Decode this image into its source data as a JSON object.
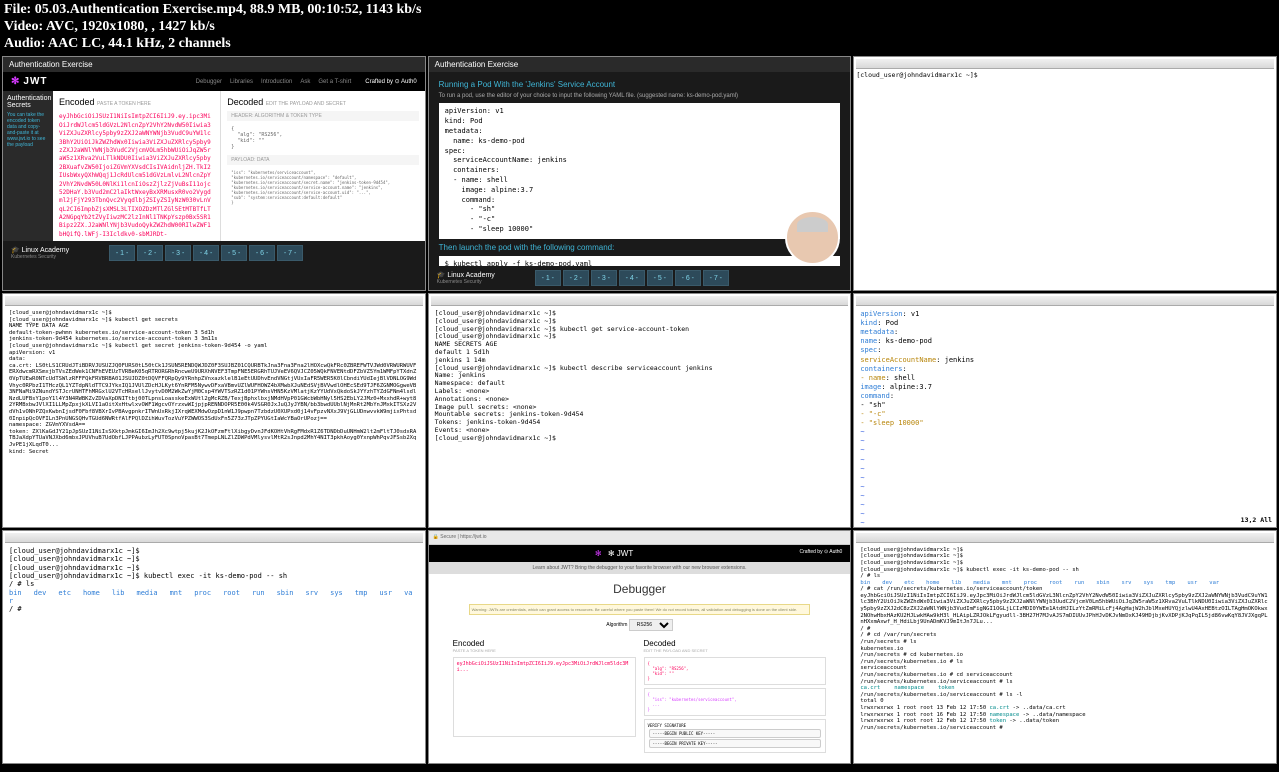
{
  "file_info": {
    "line1": "File: 05.03.Authentication Exercise.mp4, 88.9 MB, 00:10:52, 1143 kb/s",
    "line2": "Video: AVC, 1920x1080, , 1427 kb/s",
    "line3": "Audio: AAC LC, 44.1 kHz, 2 channels"
  },
  "cell1": {
    "top_title": "Authentication Exercise",
    "logo": "JWT",
    "nav": [
      "Debugger",
      "Libraries",
      "Introduction",
      "Ask",
      "Get a T-shirt"
    ],
    "crafted": "Crafted by ⊙ Auth0",
    "sidebar_title": "Authentication Secrets",
    "sidebar_text": "You can take the encoded token data and copy-and-paste it at www.jwt.io to see the payload",
    "encoded_title": "Encoded",
    "encoded_sub": "PASTE A TOKEN HERE",
    "decoded_title": "Decoded",
    "decoded_sub": "EDIT THE PAYLOAD AND SECRET",
    "section_header": "HEADER: ALGORITHM & TOKEN TYPE",
    "section_payload": "PAYLOAD: DATA",
    "json_header": "{\n  \"alg\": \"RS256\",\n  \"kid\": \"\"\n}",
    "json_payload": "\"iss\": \"kubernetes/serviceaccount\",\n\"kubernetes.io/serviceaccount/namespace\": \"default\",\n\"kubernetes.io/serviceaccount/secret.name\": \"jenkins-token-9d454\",\n\"kubernetes.io/serviceaccount/service-account.name\": \"jenkins\",\n\"kubernetes.io/serviceaccount/service-account.uid\": \"...\",\n\"sub\": \"system:serviceaccount:default:default\"\n}",
    "token": {
      "p1": "eyJhbGciOiJSUzI1NiIsImtpZCI6IiJ9.ey.ipc3MiOiJrdWJlcm5ldGVzL2NlcnZpY2VhY2NvdW50Iiwia3ViZXJuZXRlcy5pby9zZXJ2aWNYWNjb3VudC9uYW1lc3BhY2UiOiJkZWZhdWx0Iiwia3ViZXJuZXRlcy5pby9zZXJ2aWNlYWNjb3VudC2VjcmVOLm5hbWUiOiJqZW5raW5z1XRva2VuLTlkNDU0Iiwia3ViZXJuZXRlcy5pby2BXuafvZW50IjoiZGVmYXVsdCIsIVAidnljZH.TkI2IUsbWxyQXhWQqj1JcRdUlcm51dGVzLmlvL2NlcnZpY2VhY2NvdW50L0NlKi1lcnIiOszZjlzZjVuBsI11ojc52DHaY.b3Vud2mC2laIktWxeyBxXRMusxR0vo2Vygdml2jFjY293TbnQvc2VyqdlbjZSIyZSIyNzW030vLnVqL2CI6ImpbZjsXMSL3LTIXOZDzMTlZGl5EtMTBTfLTA2NGpqYb2tZVyIiwzMC2lzInNl1TNKpYszp0Bx5SR1Bipz2ZX.J2aWNlYNjb3VudoQykZWZhdW00RIlwZWF1bHQifQ.lWFj-I3Icldkv0-sbMJRDt-",
      "p2": ""
    },
    "footer_logo": "🎓 Linux Academy",
    "footer_sub": "Kubernetes Security",
    "pager": [
      "- 1 -",
      "- 2 -",
      "- 3 -",
      "- 4 -",
      "- 5 -",
      "- 6 -",
      "- 7 -"
    ]
  },
  "cell2": {
    "top_title": "Authentication Exercise",
    "title": "Running a Pod With the 'Jenkins' Service Account",
    "desc": "To run a pod, use the editor of your choice to input the following YAML file. (suggested name: ks-demo-pod.yaml)",
    "yaml": "apiVersion: v1\nkind: Pod\nmetadata:\n  name: ks-demo-pod\nspec:\n  serviceAccountName: jenkins\n  containers:\n  - name: shell\n    image: alpine:3.7\n    command:\n      - \"sh\"\n      - \"-c\"\n      - \"sleep 10000\"",
    "launch_text": "Then launch the pod with the following command:",
    "cmd": "$ kubectl apply -f ks-demo-pod.yaml\n\npod/ks-demo-pod created"
  },
  "cell3": {
    "prompt": "[cloud_user@johndavidmarx1c ~]$"
  },
  "cell4": {
    "lines": [
      "[cloud_user@johndavidmarx1c ~]$",
      "[cloud_user@johndavidmarx1c ~]$ kubectl get secrets",
      "NAME                   TYPE                                   DATA   AGE",
      "default-token-pwhmn    kubernetes.io/service-account-token    3      5d1h",
      "jenkins-token-9d454    kubernetes.io/service-account-token    3      3m11s",
      "[cloud_user@johndavidmarx1c ~]$ kubectl get secret jenkins-token-9d454 -o yaml",
      "apiVersion: v1",
      "data:"
    ],
    "ca_crt": "  ca.crt: LS0tLS1CRUdJTiBDRVJUSUZJQ0FURS0tL50tCk1JSUN5RENDQWJDZ0F3SUJBZ01CQURBTkJna3Fna3Fna2lHOXcwQkFRc0ZBREFWTVJWd0VRWURWUVFERXdwcmRXSmxjbTVsZEdWek1CNFhEVEUzTVRBeK05qRTRORGRhRncweU9URXhNVEF3TmpFNE5ERGRhTUJVeEV6QVJCZ05WQkFNVENtdDFZbVZ5Ym1WMFpYTXdnZ0VpTUEwR0NTcUdTSWlzRFFFQkFRVBRBA01JSUJDZ0tDQVFFQRpQy9YRnhpZVnxazklelB1eEtUUDhvEndVNGtjVUxIaFR5WER5K0lCbndiYUdIejBlVDNLOG9WdVhyc0RPbzI1THczQL1YZTdpNldTTC9JYkxIQ1JVUlZDcHJLKyt6YnRFM5NywvDFxaVBmvUZlWUFHOWZ4bXMwbXJuNEdSVjBVVwdlOHEcSEd9TJF6ZGNMOGgweVB3NFNaMi9ZNundYSTJcrUNHTFhMRGxlU2VTcHRsellJvytvD0M2WkZwYjM0Csp4YWVTSzRZ1d01PYWhsVHN5KzVMlatjKzYYUdVxQkdoSkJYYzhTYZdGFNm4lsdlNzdLUFBsY1poY1l4Y3N4RWBKZvZDVaXpDNITtbj00TLpnsLoasskeExWUtl2gMcRZB/TexjBphxlbxjNMdHVpP01GWcbWbHNyl5HS2EbLY2JMz0+MxxhdR+wyt82YRMBxbwJVlXI1LLMpZpxjkXLVI1aOitXxHtwlxvOWF1WgcvOYrzxwWIjpjpRENNDOPR5E00k4VSGR0JxJuQJyJYBN/bb3bwdUUblNjMnRt2MbYnJMxkITSXz2VdVh1vONhPZQxKwbnIjsdF0Fbf8VBXrIvPBAvgpnkrITWnUxRkjIXrqWEXMdwOzpD1nW1J9pwpn7TzbdzU0XUPxd0j14vFpzvNXxJ9VjGLUDnwvvkW9mjixPhtsd0InpipQcOVFILn3PnUNGSQHvTGUd6NWRtfAlFPQlDZihWuvTozVuYPZWWOS3SdUxFn5Z73zJTpZPYUGtIaWcYBaOrUPozj==",
    "ns": "  namespace: ZGVmYXVsdA==",
    "token_label": "  token:",
    "token_val": "ZXlKaGdJY21pJpSUzI1NiIsSXktpJmkGI6ImJh2Xc9wtpj5kujK2JkOFzmFtlXibgyDvnJFdKOHtVhRgFMdxR1Z6TDNDbDuUNHmW2lt2mFltTJ0sdxRATBJaXdpYTUaVNJXbd6mbxJPUVhuB7UdObfLJPPAubzLyFUT0SpnoVpasBt7TmepLNLZlZDWPdVMlysvlMtR2sJnpd2MhY4NIT3pkhAoyg0YxnpWhPqvJFSsb2XqJvPE1jXLqdT0...",
    "kind": "kind: Secret"
  },
  "cell5": {
    "lines": [
      "[cloud_user@johndavidmarx1c ~]$",
      "[cloud_user@johndavidmarx1c ~]$",
      "[cloud_user@johndavidmarx1c ~]$ kubectl get service-account-token",
      "[cloud_user@johndavidmarx1c ~]$",
      "NAME      SECRETS   AGE",
      "default   1         5d1h",
      "jenkins   1         14m",
      "[cloud_user@johndavidmarx1c ~]$ kubectl describe serviceaccount jenkins",
      "Name:                jenkins",
      "Namespace:           default",
      "Labels:              <none>",
      "Annotations:         <none>",
      "Image pull secrets:  <none>",
      "Mountable secrets:   jenkins-token-9d454",
      "Tokens:              jenkins-token-9d454",
      "Events:              <none>",
      "[cloud_user@johndavidmarx1c ~]$ "
    ]
  },
  "cell6": {
    "yaml_lines": [
      {
        "text": "apiVersion",
        "color": "blue",
        "val": ": v1"
      },
      {
        "text": "kind",
        "color": "blue",
        "val": ": Pod"
      },
      {
        "text": "metadata",
        "color": "blue",
        "val": ":"
      },
      {
        "text": "  name",
        "color": "blue",
        "val": ": ks-demo-pod"
      },
      {
        "text": "spec",
        "color": "blue",
        "val": ":"
      },
      {
        "text": "  serviceAccountName",
        "color": "gold",
        "val": ": jenkins"
      },
      {
        "text": "  containers",
        "color": "blue",
        "val": ":"
      },
      {
        "text": "  - name",
        "color": "gold",
        "val": ": shell"
      },
      {
        "text": "    image",
        "color": "blue",
        "val": ": alpine:3.7"
      },
      {
        "text": "    command",
        "color": "blue",
        "val": ":"
      },
      {
        "text": "      -",
        "color": "",
        "val": " \"sh\""
      },
      {
        "text": "      - \"-c\"",
        "color": "gold",
        "val": ""
      },
      {
        "text": "      - \"sleep 10000\"",
        "color": "gold",
        "val": ""
      }
    ],
    "status": "13,2          All"
  },
  "cell7": {
    "lines": [
      "[cloud_user@johndavidmarx1c ~]$",
      "[cloud_user@johndavidmarx1c ~]$",
      "[cloud_user@johndavidmarx1c ~]$",
      "[cloud_user@johndavidmarx1c ~]$ kubectl exec -it ks-demo-pod -- sh",
      "/ # ls"
    ],
    "ls_items": [
      "bin",
      "dev",
      "etc",
      "home",
      "lib",
      "media",
      "mnt",
      "proc",
      "root",
      "run",
      "sbin",
      "srv",
      "sys",
      "tmp",
      "usr",
      "var"
    ],
    "prompt": "/ # "
  },
  "cell8": {
    "url": "🔒 Secure | https://jwt.io",
    "logo": "✻ JWT",
    "crafted": "Crafted by ⊙ Auth0",
    "banner": "Learn about JWT? Bring the debugger to your favorite browser with our new browser extensions.",
    "debugger": "Debugger",
    "warning": "Warning: JWTs are credentials, which can grant access to resources. Be careful where you paste them! We do not record tokens, all validation and debugging is done on the client side.",
    "algo_label": "Algorithm",
    "algo_value": "RS256",
    "encoded": "Encoded",
    "encoded_sub": "PASTE A TOKEN HERE",
    "decoded": "Decoded",
    "decoded_sub": "EDIT THE PAYLOAD AND SECRET",
    "token_preview": "eyJhbGciOiJSUzI1NiIsImtpZCI6IiJ9.eyJpc3MiOiJrdWJlcm5ldc3Mi...",
    "header_json": "{\n  \"alg\": \"RS256\",\n  \"kid\": \"\"\n}",
    "payload_json": "{\n  \"iss\": \"kubernetes/serviceaccount\",\n  ...\n}",
    "verify_label": "VERIFY SIGNATURE"
  },
  "cell9": {
    "lines_pre": [
      "[cloud_user@johndavidmarx1c ~]$",
      "[cloud_user@johndavidmarx1c ~]$",
      "[cloud_user@johndavidmarx1c ~]$",
      "[cloud_user@johndavidmarx1c ~]$ kubectl exec -it ks-demo-pod -- sh",
      "/ # ls"
    ],
    "ls_items": [
      "bin",
      "dev",
      "etc",
      "home",
      "lib",
      "media",
      "mnt",
      "proc",
      "root",
      "run",
      "sbin",
      "srv",
      "sys",
      "tmp",
      "usr",
      "var"
    ],
    "cat_line": "/ # cat /run/secrets/kubernetes.io/serviceaccount/token",
    "token_blob": "eyJhbGciOiJSUzI1NiIsImtpZCI6IiJ9.eyJpc3MiOiJrdWJlcm5ldGVzL3NlcnZpY2VhY2NvdW50Iiwia3ViZXJuZXRlcy5pby9zZXJ2aWNYWNjb3VudC9uYW1lc3BhY2UiOiJkZWZhdWx0Iiwia3ViZXJuZXRlcy5pby9zZXJ2aWNlYWNjb3UudC2VjcmV0Lm5hbWUiOiJqZW5raW5z1XRva2VuLTlkNDU0Iiwia3ViZXJuZXRlcy5pby9zZXJ2dC8zZXJ2aWNlYWNjb3VudImFigNGI1OGLjLCIzMDI0YWEe1AtdHJILzYtZmRMiLcFj4AgHajW2hJblMxeHUYQjzlwU4AxHEBtzOILTAgHmOKOkwx2NOhwHbxHAzKU2HJLwkHAw9kH3l_HLAipLZRJOkLFgyudll-3BH27H7MJvAJS7mDIUUvJPhHJvDKJvNmDxKJ49HDjbjKvXDPjKJqPqIL5jd86vwKqY8JVJXgqPLnHXxmAxwf_H_HdiLbj9UnADmKVJ9mItJn7JLu...",
    "post_lines": [
      "/ #",
      "/ # cd /var/run/secrets",
      "/run/secrets # ls",
      "kubernetes.io",
      "/run/secrets # cd kubernetes.io",
      "/run/secrets/kubernetes.io # ls",
      "serviceaccount",
      "/run/secrets/kubernetes.io # cd serviceaccount",
      "/run/secrets/kubernetes.io/serviceaccount # ls"
    ],
    "sa_ls": [
      "ca.crt",
      "namespace",
      "token"
    ],
    "ls_l_cmd": "/run/secrets/kubernetes.io/serviceaccount # ls -l",
    "ls_l_out": [
      "total 0",
      "lrwxrwxrwx    1 root     root            13 Feb 12 17:50 ca.crt -> ..data/ca.crt",
      "lrwxrwxrwx    1 root     root            16 Feb 12 17:50 namespace -> ..data/namespace",
      "lrwxrwxrwx    1 root     root            12 Feb 12 17:50 token -> ..data/token"
    ],
    "final_prompt": "/run/secrets/kubernetes.io/serviceaccount #"
  }
}
